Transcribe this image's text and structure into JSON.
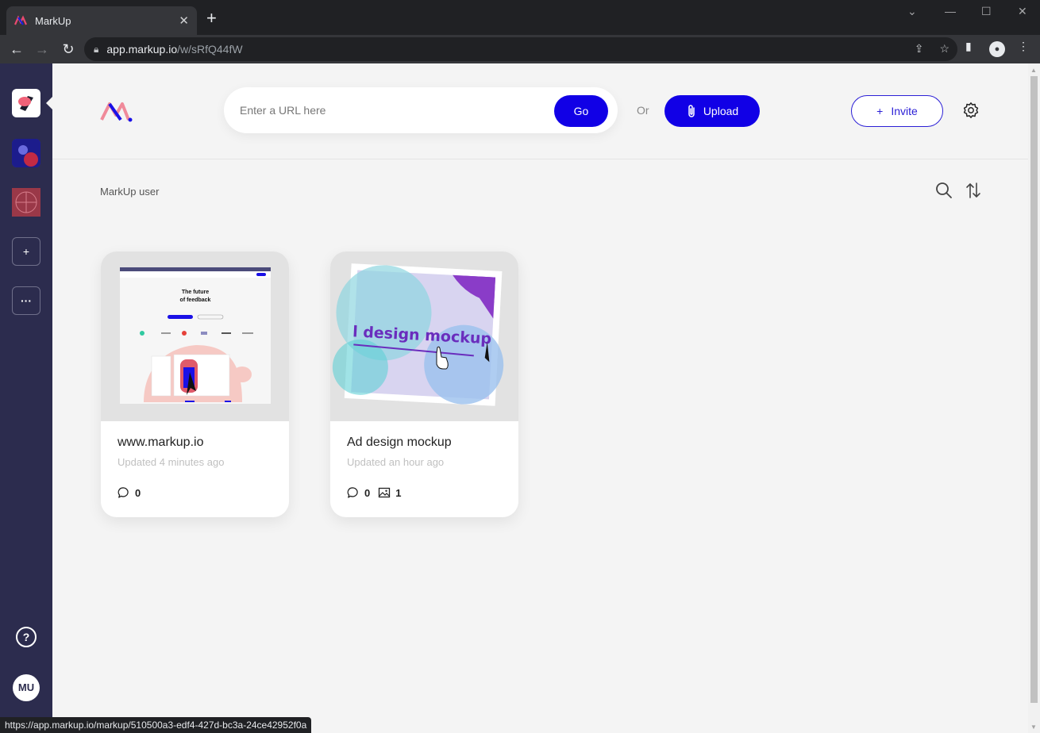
{
  "browser": {
    "tab_title": "MarkUp",
    "url_host": "app.markup.io",
    "url_path": "/w/sRfQ44fW",
    "status_url": "https://app.markup.io/markup/510500a3-edf4-427d-bc3a-24ce42952f0a"
  },
  "sidebar": {
    "add_label": "+",
    "more_label": "···",
    "help_label": "?",
    "avatar_initials": "MU"
  },
  "header": {
    "url_placeholder": "Enter a URL here",
    "go_label": "Go",
    "or_label": "Or",
    "upload_label": "Upload",
    "invite_label": "Invite",
    "invite_plus": "+"
  },
  "workspace": {
    "name": "MarkUp user"
  },
  "cards": [
    {
      "title": "www.markup.io",
      "updated": "Updated 4 minutes ago",
      "comments": "0"
    },
    {
      "title": "Ad design mockup",
      "updated": "Updated an hour ago",
      "comments": "0",
      "images": "1"
    }
  ],
  "thumbs": {
    "site_heading_1": "The future",
    "site_heading_2": "of feedback",
    "mockup_text": "l design mockup"
  },
  "colors": {
    "brand": "#1100e6",
    "rail": "#2c2c4e"
  }
}
